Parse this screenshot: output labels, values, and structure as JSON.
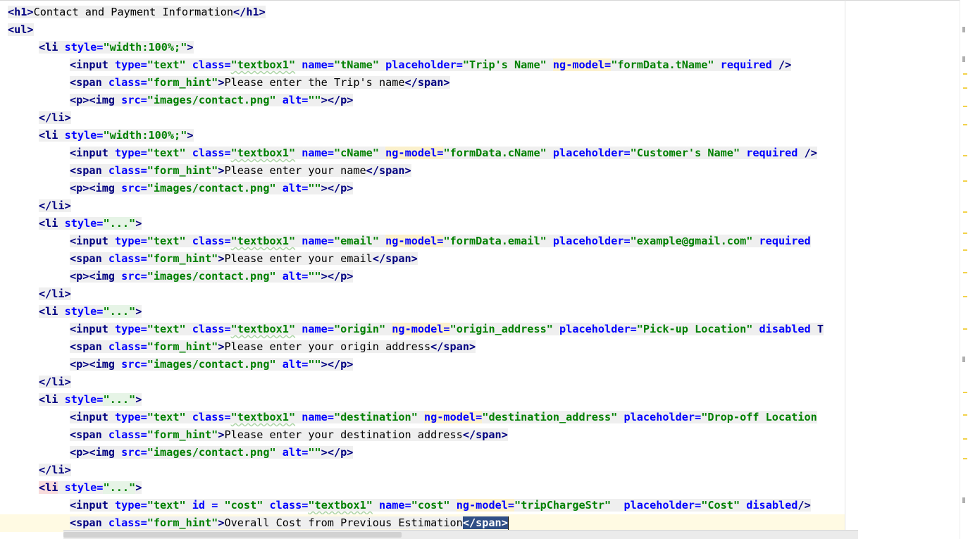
{
  "editor": {
    "language": "html",
    "current_line_text": "<span class=\"form_hint\">Overall Cost from Previous Estimation</span>",
    "tokens": {
      "h1_open": "<h1>",
      "h1_text": "Contact and Payment Information",
      "h1_close": "</h1>",
      "ul_open": "<ul>",
      "li": "<li",
      "li_close": "</li>",
      "gt": ">",
      "style_attr": "style=",
      "width_value": "\"width:100%;\"",
      "dots_value": "\"...\"",
      "input": "<input",
      "self_close": "/>",
      "self_close_no_space": "/>",
      "type_attr": "type=",
      "text_value": "\"text\"",
      "class_attr": "class=",
      "textbox_value": "\"textbox1\"",
      "name_attr": "name=",
      "placeholder_attr": "placeholder=",
      "ngmodel_attr": "ng-model=",
      "required": "required",
      "disabled": "disabled",
      "id_attr": "id = ",
      "tName": "\"tName\"",
      "tName_ph": "\"Trip's Name\"",
      "tName_model": "\"formData.tName\"",
      "cName": "\"cName\"",
      "cName_model": "\"formData.cName\"",
      "cName_ph": "\"Customer's Name\"",
      "email": "\"email\"",
      "email_model": "\"formData.email\"",
      "email_ph": "\"example@gmail.com\"",
      "origin": "\"origin\"",
      "origin_model": "\"origin_address\"",
      "origin_ph": "\"Pick-up Location\"",
      "destination": "\"destination\"",
      "destination_model": "\"destination_address\"",
      "destination_ph": "\"Drop-off Location",
      "cost_id": "\"cost\"",
      "cost_name": "\"cost\"",
      "cost_model": "\"tripChargeStr\"",
      "cost_ph": "\"Cost\"",
      "span_open": "<span",
      "span_close": "</span>",
      "hint_value": "\"form_hint\"",
      "hint_trip": "Please enter the Trip's name",
      "hint_name": "Please enter your name",
      "hint_email": "Please enter your email",
      "hint_origin": "Please enter your origin address",
      "hint_destination": "Please enter your destination address",
      "hint_cost": "Overall Cost from Previous Estimation",
      "p_open": "<p>",
      "p_close": "</p>",
      "img": "<img",
      "src_attr": "src=",
      "contact_src": "\"images/contact.png\"",
      "alt_attr": "alt=",
      "empty_value": "\"\"",
      "truncated_tail": "T"
    }
  },
  "colors": {
    "tag": "#000080",
    "attribute": "#0000ff",
    "string": "#008000",
    "tag_background": "#efefef",
    "current_line": "#fffae3",
    "selection": "#2f4f86",
    "marker_yellow": "#f2d24b"
  },
  "icons": [
    "fold-marker-icon",
    "warning-stripe-icon"
  ]
}
